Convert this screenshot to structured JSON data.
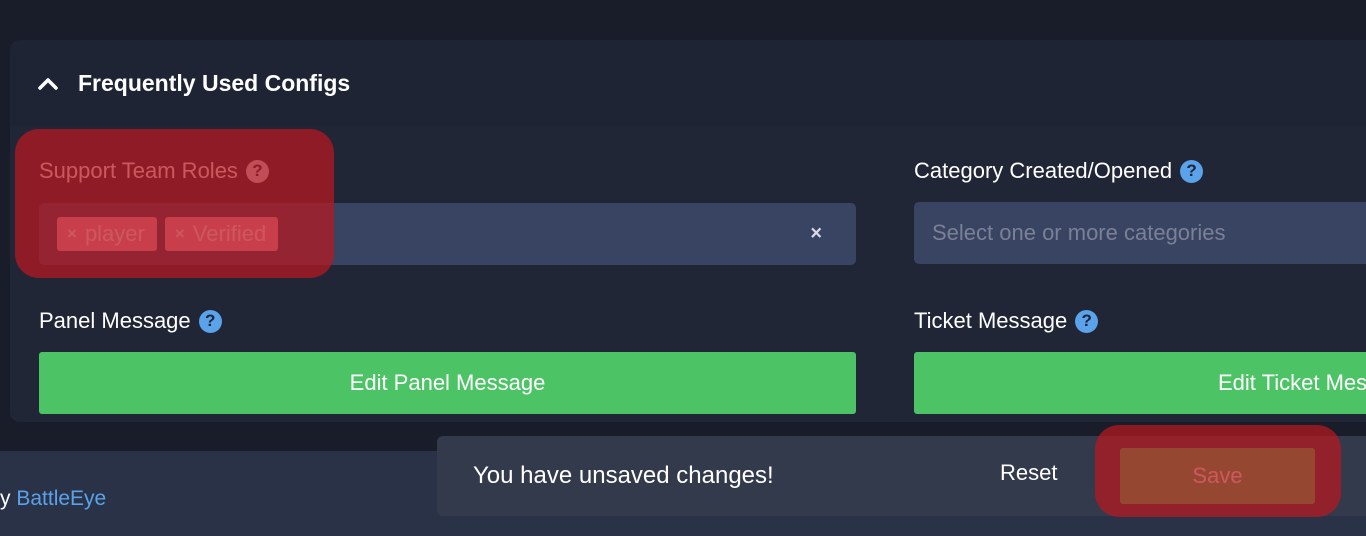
{
  "panel": {
    "title": "Frequently Used Configs",
    "collapse_icon": "chevron-up-icon"
  },
  "fields": {
    "support_roles": {
      "label": "Support Team Roles",
      "help_icon": "?",
      "tags": [
        {
          "remove": "×",
          "label": "player"
        },
        {
          "remove": "×",
          "label": "Verified"
        }
      ],
      "clear_icon": "×"
    },
    "category": {
      "label": "Category Created/Opened",
      "help_icon": "?",
      "placeholder": "Select one or more categories"
    },
    "panel_message": {
      "label": "Panel Message",
      "help_icon": "?",
      "button": "Edit Panel Message"
    },
    "ticket_message": {
      "label": "Ticket Message",
      "help_icon": "?",
      "button": "Edit Ticket Message"
    }
  },
  "footer": {
    "prefix": "y ",
    "link": "BattleEye"
  },
  "unsaved": {
    "message": "You have unsaved changes!",
    "reset_label": "Reset",
    "save_label": "Save"
  },
  "colors": {
    "accent_green": "#4cc466",
    "help_blue": "#5aa2ea",
    "tag_pink": "#f4a2b9",
    "highlight_red": "#b91820"
  }
}
